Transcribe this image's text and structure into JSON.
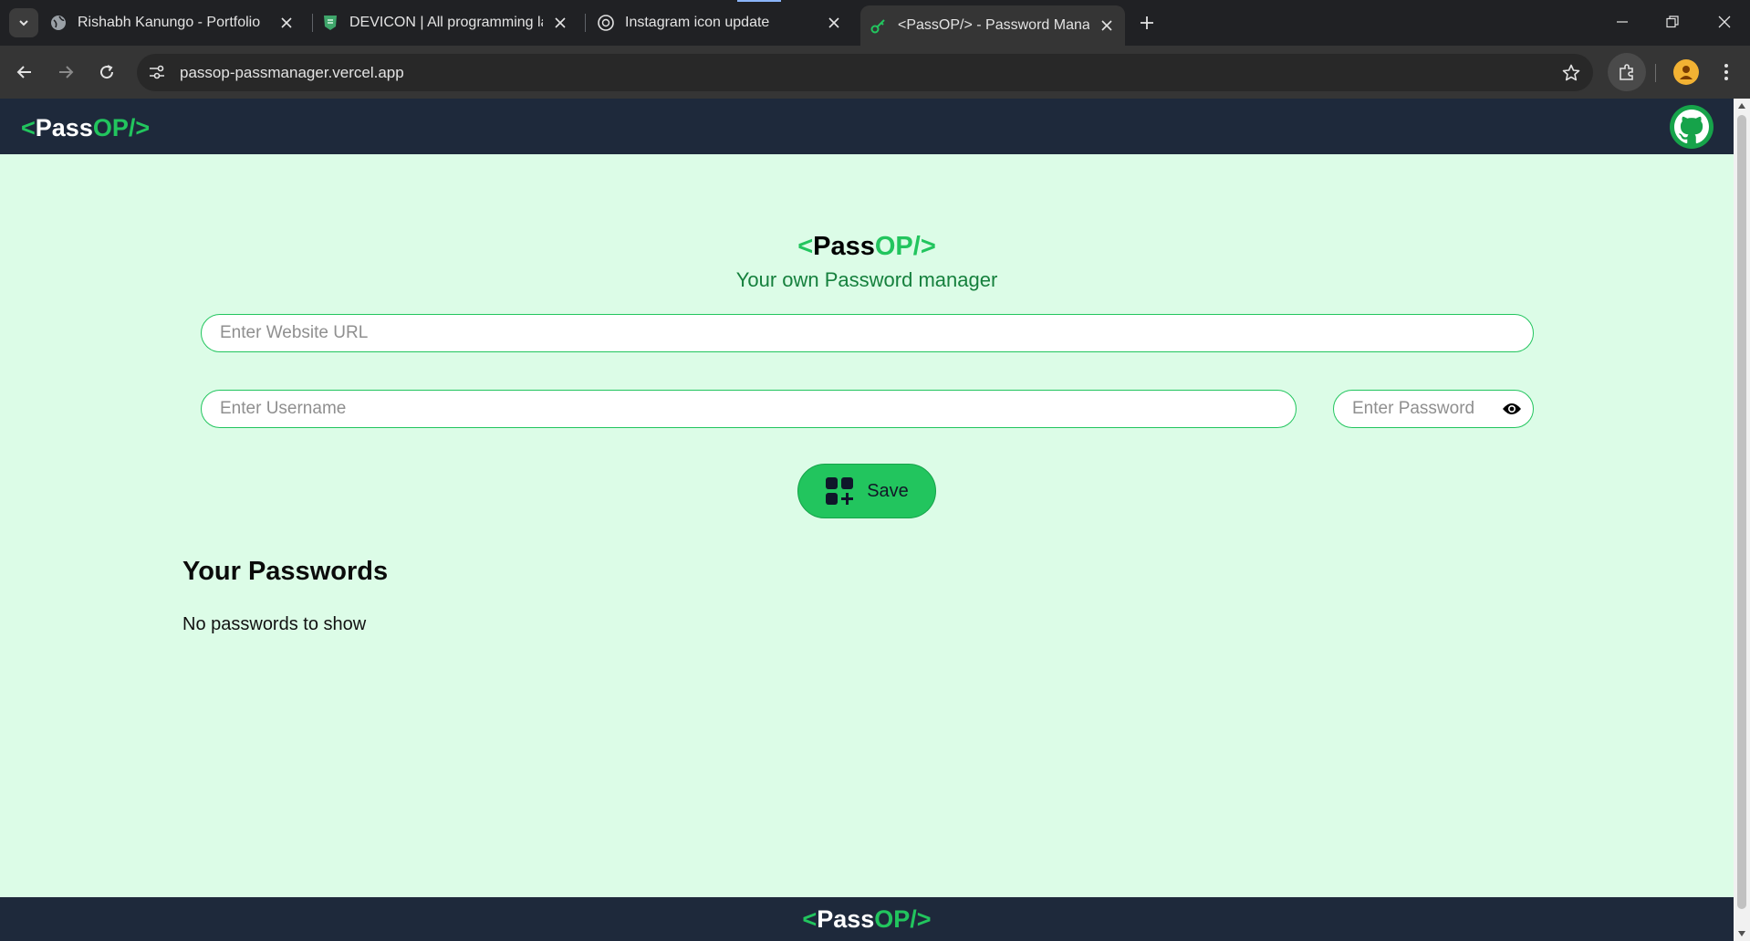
{
  "browser": {
    "tabs": [
      {
        "title": "Rishabh Kanungo - Portfolio",
        "favicon": "globe-icon",
        "active": false
      },
      {
        "title": "DEVICON | All programming languages",
        "favicon": "shield-icon",
        "active": false
      },
      {
        "title": "Instagram icon update",
        "favicon": "chatgpt-icon",
        "active": false
      },
      {
        "title": "<PassOP/> - Password Manager",
        "favicon": "key-icon",
        "active": true
      }
    ],
    "url": "passop-passmanager.vercel.app"
  },
  "app": {
    "logo": {
      "open": "<",
      "pass": "Pass",
      "op": "OP/",
      "close": ">"
    },
    "tagline": "Your own Password manager",
    "form": {
      "url_placeholder": "Enter Website URL",
      "username_placeholder": "Enter Username",
      "password_placeholder": "Enter Password",
      "save_label": "Save"
    },
    "passwords": {
      "title": "Your Passwords",
      "empty_message": "No passwords to show"
    }
  },
  "colors": {
    "accent": "#22c55e",
    "nav_bg": "#1e293b",
    "page_bg": "#dcfce7",
    "tagline": "#15803d"
  }
}
